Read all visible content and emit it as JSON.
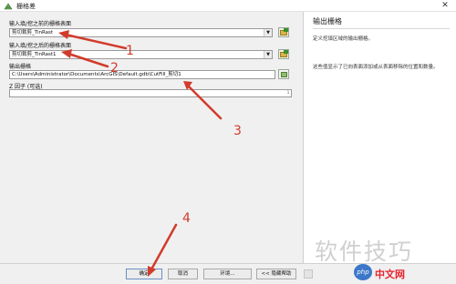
{
  "window": {
    "title": "栅格差",
    "close_glyph": "✕"
  },
  "form": {
    "input1_label": "输入填/挖之前的栅格表面",
    "input1_value": "剪切裁剪_TinRast",
    "input2_label": "输入填/挖之后的栅格表面",
    "input2_value": "剪切裁剪_TinRast1",
    "output_label": "输出栅格",
    "output_value": "C:\\Users\\Administrator\\Documents\\ArcGIS\\Default.gdb\\CutFill_剪切1",
    "zfactor_label": "Z 因子 (可选)",
    "zfactor_value": "1"
  },
  "help": {
    "title": "输出栅格",
    "p1": "定义挖填区域的输出栅格。",
    "p2": "这些值显示了已向表面添加或从表面移除的位置和数量。"
  },
  "buttons": {
    "ok": "确定",
    "cancel": "取消",
    "environments": "环境...",
    "hide_help": "<< 隐藏帮助"
  },
  "annotations": [
    "1",
    "2",
    "3",
    "4"
  ],
  "watermark": {
    "text": "软件技巧",
    "site_logo": "php",
    "site_name": "中文网"
  },
  "colors": {
    "annotation_red": "#d23b2b",
    "brand_blue": "#3c77c9"
  }
}
